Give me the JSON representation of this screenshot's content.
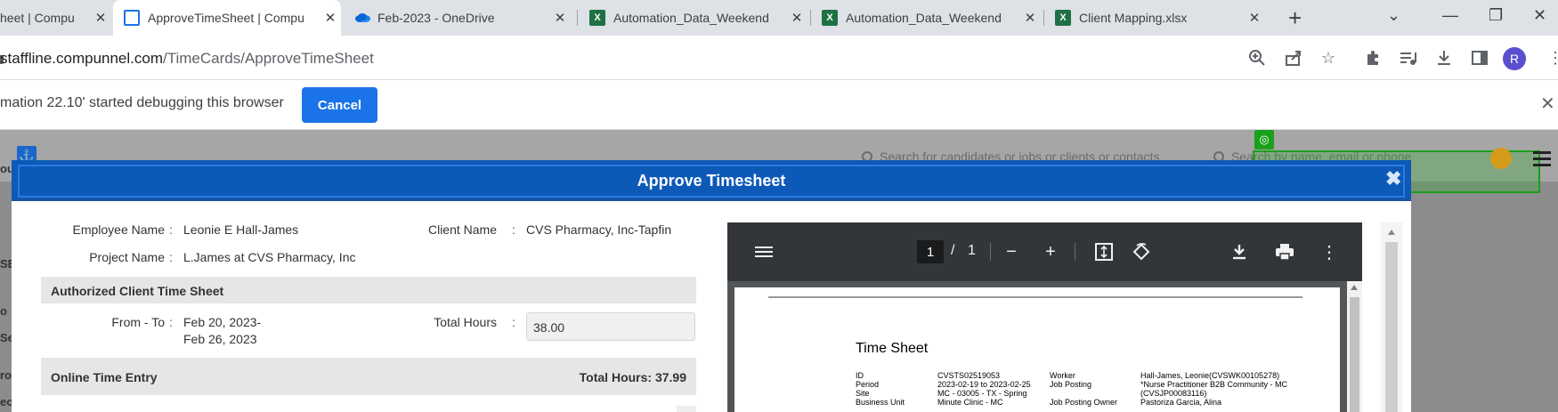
{
  "browser": {
    "tabs": [
      {
        "title": "heet | Compu",
        "icon": "frame-icon",
        "active": false
      },
      {
        "title": "ApproveTimeSheet | Compu",
        "icon": "frame-icon",
        "active": true
      },
      {
        "title": "Feb-2023 - OneDrive",
        "icon": "onedrive-icon",
        "active": false
      },
      {
        "title": "Automation_Data_Weekend",
        "icon": "excel-icon",
        "active": false
      },
      {
        "title": "Automation_Data_Weekend",
        "icon": "excel-icon",
        "active": false
      },
      {
        "title": "Client Mapping.xlsx",
        "icon": "excel-icon",
        "active": false
      }
    ],
    "url_host": "staffline.compunnel.com",
    "url_path": "/TimeCards/ApproveTimeSheet",
    "profile_initial": "R",
    "excel_letter": "X",
    "debug_message": "mation 22.10' started debugging this browser",
    "cancel_label": "Cancel"
  },
  "background_page": {
    "search_candidates_placeholder": "Search for candidates or jobs or clients or contacts",
    "search_people_placeholder": "Search by name, email or phone",
    "sidebar_fragments": [
      "ou",
      "SE",
      "o",
      "Se",
      "ro",
      "ec"
    ]
  },
  "modal": {
    "title": "Approve Timesheet",
    "employee_name_label": "Employee Name",
    "employee_name": "Leonie E Hall-James",
    "client_name_label": "Client Name",
    "client_name": "CVS Pharmacy, Inc-Tapfin",
    "project_name_label": "Project Name",
    "project_name": "L.James at CVS Pharmacy, Inc",
    "authorized_section_title": "Authorized Client Time Sheet",
    "from_to_label": "From - To",
    "from_date": "Feb 20, 2023-",
    "to_date": "Feb 26, 2023",
    "total_hours_label": "Total Hours",
    "total_hours_value": "38.00",
    "online_entry_title": "Online Time Entry",
    "online_total_hours": "Total Hours: 37.99"
  },
  "pdf_viewer": {
    "current_page": "1",
    "page_separator": "/",
    "total_pages": "1",
    "document_title": "Time Sheet",
    "rows": [
      {
        "label": "ID",
        "value": "CVSTS02519053",
        "label2": "Worker",
        "value2": "Hall-James, Leonie(CVSWK00105278)"
      },
      {
        "label": "Period",
        "value": "2023-02-19 to 2023-02-25",
        "label2": "Job Posting",
        "value2": "*Nurse Practitioner B2B Community - MC"
      },
      {
        "label": "",
        "value": "",
        "label2": "",
        "value2": "(CVSJP00083116)"
      },
      {
        "label": "Site",
        "value": "MC - 03005 - TX - Spring",
        "label2": "",
        "value2": ""
      },
      {
        "label": "Business Unit",
        "value": "Minute Clinic - MC",
        "label2": "Job Posting Owner",
        "value2": "Pastoriza Garcia, Alina"
      }
    ]
  }
}
